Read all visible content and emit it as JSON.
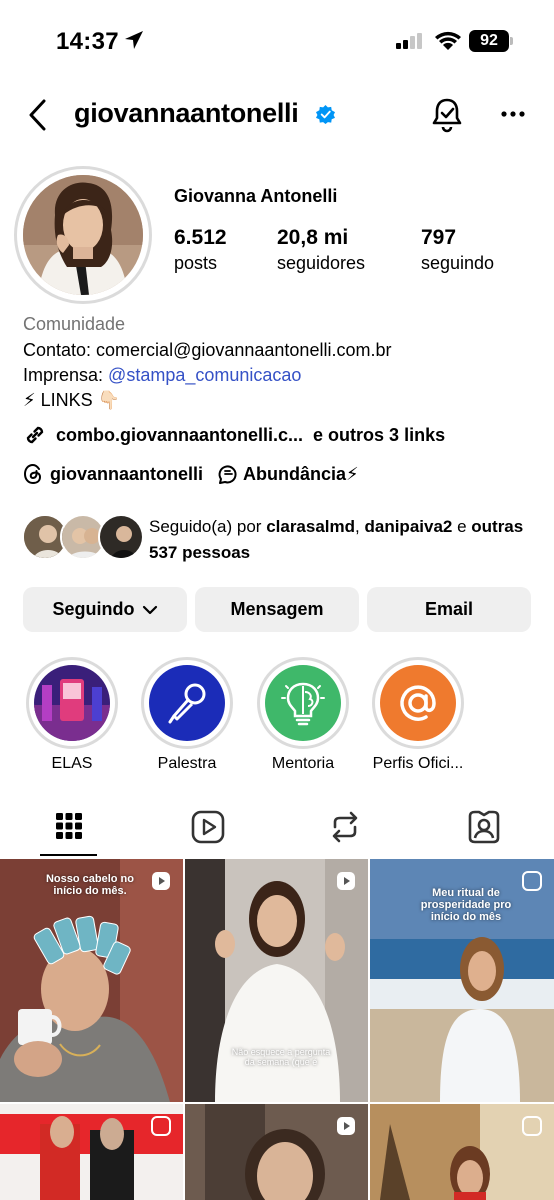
{
  "status_bar": {
    "time": "14:37",
    "battery": "92"
  },
  "header": {
    "username": "giovannaantonelli"
  },
  "profile": {
    "full_name": "Giovanna Antonelli",
    "stats": [
      {
        "value": "6.512",
        "label": "posts"
      },
      {
        "value": "20,8 mi",
        "label": "seguidores"
      },
      {
        "value": "797",
        "label": "seguindo"
      }
    ],
    "category": "Comunidade",
    "contact": "Contato: comercial@giovannaantonelli.com.br",
    "press_prefix": "Imprensa: ",
    "press_mention": "@stampa_comunicacao",
    "links_line": "⚡ LINKS 👇🏻",
    "link_url": "combo.giovannaantonelli.c...",
    "more_links": "e outros 3 links",
    "threads_handle": "giovannaantonelli",
    "channel_name": "Abundância⚡",
    "followed_prefix": "Seguido(a) por ",
    "followed_user1": "clarasalmd",
    "followed_sep": ", ",
    "followed_user2": "danipaiva2",
    "followed_and": " e ",
    "followed_rest": "outras 537 pessoas"
  },
  "actions": {
    "following": "Seguindo",
    "message": "Mensagem",
    "email": "Email"
  },
  "highlights": [
    {
      "label": "ELAS"
    },
    {
      "label": "Palestra"
    },
    {
      "label": "Mentoria"
    },
    {
      "label": "Perfis Ofici..."
    }
  ],
  "posts": [
    {
      "caption": "Nosso cabelo no início do mês."
    },
    {
      "caption": "Não esquece a pergunta da semana (que é"
    },
    {
      "caption": "Meu ritual de prosperidade pro início do mês"
    }
  ],
  "colors": {
    "accent": "#3551c6",
    "verified": "#0095f6",
    "button_bg": "#efefef"
  }
}
